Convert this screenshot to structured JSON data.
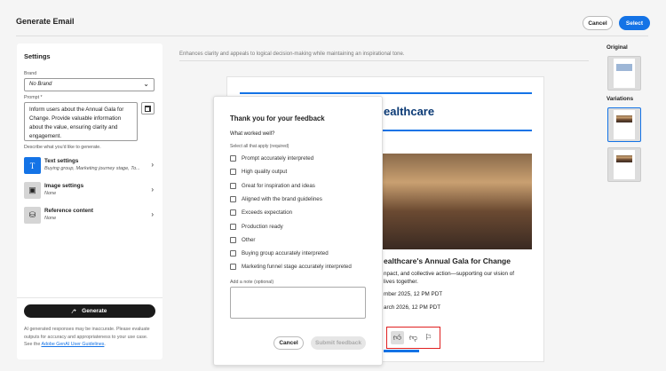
{
  "header": {
    "title": "Generate Email",
    "cancel_label": "Cancel",
    "select_label": "Select"
  },
  "settings": {
    "title": "Settings",
    "brand_label": "Brand",
    "brand_value": "No Brand",
    "prompt_label": "Prompt *",
    "prompt_value": "Inform users about the Annual Gala for Change. Provide valuable information about the value, ensuring clarity and engagement.",
    "prompt_help": "Describe what you'd like to generate.",
    "items": [
      {
        "title": "Text settings",
        "subtitle": "Buying group, Marketing journey stage, To...",
        "icon": "text-icon"
      },
      {
        "title": "Image settings",
        "subtitle": "None",
        "icon": "image-icon"
      },
      {
        "title": "Reference content",
        "subtitle": "None",
        "icon": "reference-icon"
      }
    ],
    "generate_label": "Generate",
    "disclaimer": "AI generated responses may be inaccurate. Please evaluate outputs for accuracy and appropriateness to your use case. See the ",
    "disclaimer_link": "Adobe GenAI User Guidelines",
    "disclaimer_end": "."
  },
  "main": {
    "caption": "Enhances clarity and appeals to logical decision-making while maintaining an inspirational tone.",
    "email": {
      "heading_fragment": "ealthcare",
      "subheading_fragment": "ealthcare's Annual Gala for Change",
      "body_line1": "npact, and collective action—supporting our vision of",
      "body_line2": "lives together.",
      "date1": "mber 2025, 12 PM PDT",
      "date2": "arch 2026, 12 PM PDT"
    }
  },
  "feedback": {
    "title": "Thank you for your feedback",
    "question": "What worked well?",
    "instruction": "Select all that apply (required)",
    "options": [
      "Prompt accurately interpreted",
      "High quality output",
      "Great for inspiration and ideas",
      "Aligned with the brand guidelines",
      "Exceeds expectation",
      "Production ready",
      "Other",
      "Buying group accurately interpreted",
      "Marketing funnel stage accurately interpreted"
    ],
    "note_label": "Add a note (optional)",
    "note_value": "",
    "cancel_label": "Cancel",
    "submit_label": "Submit feedback"
  },
  "right": {
    "original_label": "Original",
    "variations_label": "Variations"
  },
  "colors": {
    "accent": "#1473e6",
    "highlight": "#e02020",
    "dark": "#1a1a1a"
  }
}
